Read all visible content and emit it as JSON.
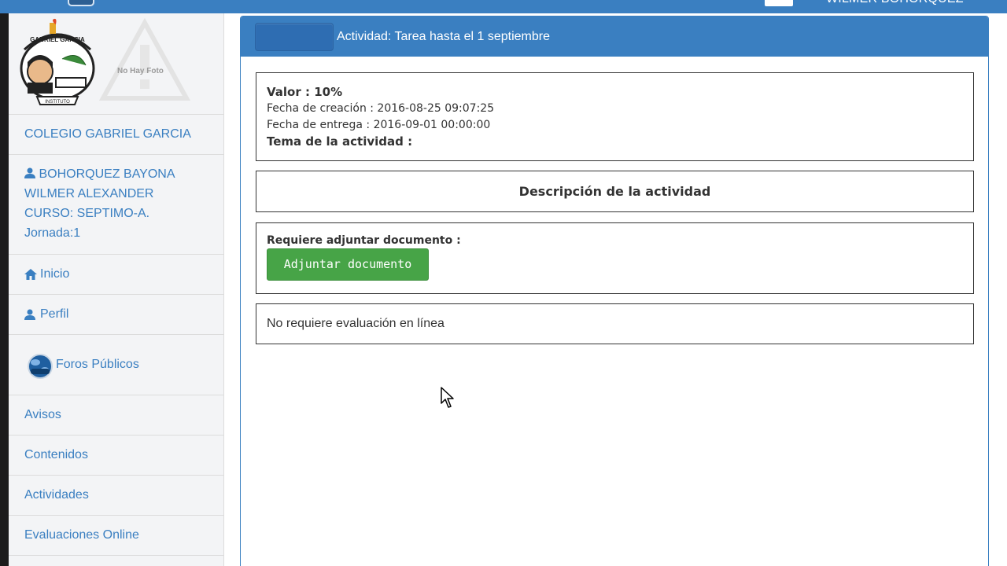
{
  "topbar": {
    "user_name": "WILMER BOHORQUEZ",
    "color": "#3a7fc1"
  },
  "sidebar": {
    "no_photo_text": "No Hay Foto",
    "school": "COLEGIO GABRIEL GARCIA",
    "user": {
      "icon": "user-icon",
      "name_line1": "BOHORQUEZ BAYONA",
      "name_line2": "WILMER ALEXANDER",
      "course": "CURSO: SEPTIMO-A.",
      "shift": "Jornada:1"
    },
    "items": [
      {
        "label": "Inicio",
        "icon": "home-icon"
      },
      {
        "label": "Perfil",
        "icon": "user-icon"
      },
      {
        "label": "Foros Públicos",
        "icon": "forum-globe-icon"
      },
      {
        "label": "Avisos"
      },
      {
        "label": "Contenidos"
      },
      {
        "label": "Actividades"
      },
      {
        "label": "Evaluaciones Online"
      }
    ]
  },
  "panel": {
    "title": "Actividad: Tarea hasta el 1 septiembre",
    "valor": "Valor : 10%",
    "fecha_creacion": "Fecha de creación : 2016-08-25 09:07:25",
    "fecha_entrega": "Fecha de entrega : 2016-09-01 00:00:00",
    "tema": "Tema de la actividad :",
    "descripcion_heading": "Descripción de la actividad",
    "requiere_label": "Requiere adjuntar documento :",
    "attach_button": "Adjuntar documento",
    "evaluacion_text": "No requiere evaluación en línea",
    "accent_color": "#3a7fc1",
    "button_color": "#47a447"
  }
}
